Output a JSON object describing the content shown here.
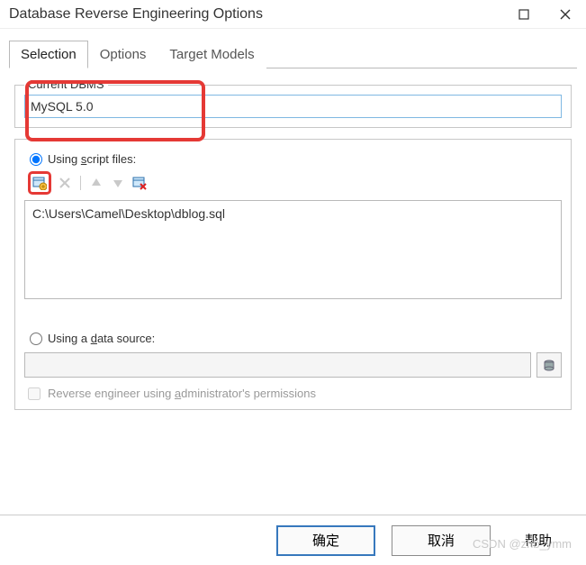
{
  "window": {
    "title": "Database Reverse Engineering Options"
  },
  "tabs": {
    "selection": "Selection",
    "options": "Options",
    "target_models": "Target Models"
  },
  "dbms": {
    "group_label": "Current DBMS",
    "value": "MySQL 5.0"
  },
  "script_section": {
    "radio_pre": "Using ",
    "radio_under": "s",
    "radio_post": "cript files:",
    "file_path": "C:\\Users\\Camel\\Desktop\\dblog.sql"
  },
  "datasource_section": {
    "radio_pre": "Using a ",
    "radio_under": "d",
    "radio_post": "ata source:",
    "checkbox_pre": "Reverse engineer using ",
    "checkbox_under": "a",
    "checkbox_post": "dministrator's permissions"
  },
  "buttons": {
    "ok": "确定",
    "cancel": "取消",
    "help": "帮助"
  },
  "watermark": "CSDN @zhb_ymm"
}
